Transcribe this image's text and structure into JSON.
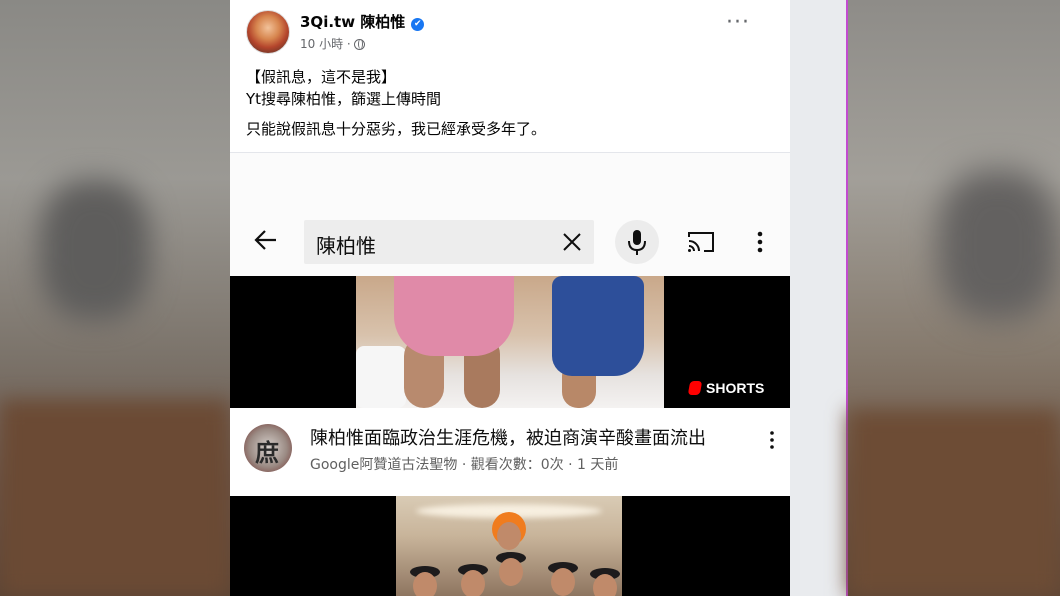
{
  "post": {
    "page_name": "3Qi.tw 陳柏惟",
    "verified_mark": "✔",
    "time": "10 小時 ·",
    "more": "···",
    "lines": [
      "【假訊息，這不是我】",
      "Yt搜尋陳柏惟，篩選上傳時間",
      "只能說假訊息十分惡劣，我已經承受多年了。"
    ]
  },
  "youtube": {
    "search_query": "陳柏惟",
    "shorts_label": "SHORTS",
    "video": {
      "title": "陳柏惟面臨政治生涯危機，被迫商演辛酸畫面流出",
      "meta": "Google阿贊道古法聖物 · 觀看次數：0次 · 1 天前",
      "channel_glyph": "庶"
    }
  },
  "colors": {
    "facebook_blue": "#1877f2",
    "youtube_red": "#ff0000",
    "divider_magenta": "#c24bd0"
  }
}
